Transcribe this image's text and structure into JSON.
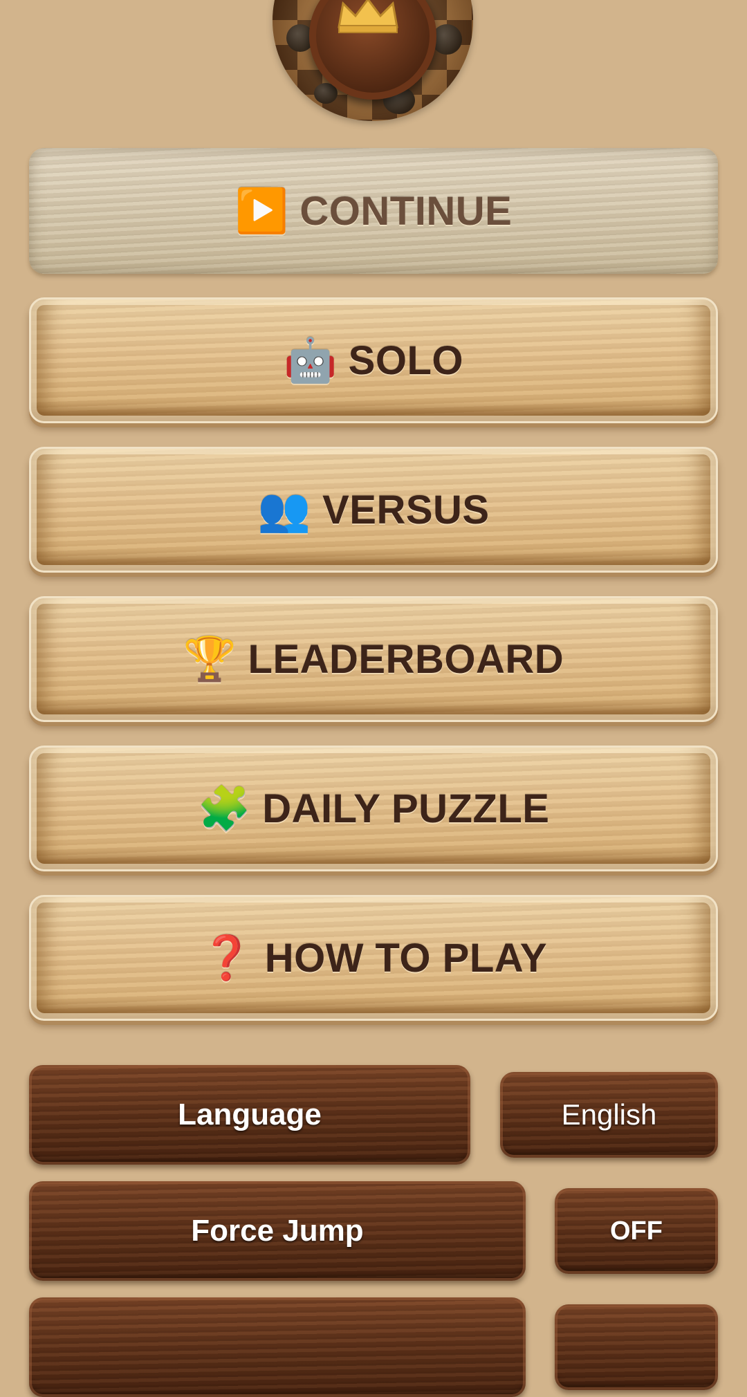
{
  "menu": {
    "continue": {
      "icon": "play-button-icon",
      "glyph": "▶️",
      "label": "CONTINUE"
    },
    "solo": {
      "icon": "robot-icon",
      "glyph": "🤖",
      "label": "SOLO"
    },
    "versus": {
      "icon": "two-people-icon",
      "glyph": "👥",
      "label": "VERSUS"
    },
    "leaderboard": {
      "icon": "trophy-icon",
      "glyph": "🏆",
      "label": "LEADERBOARD"
    },
    "daily_puzzle": {
      "icon": "puzzle-piece-icon",
      "glyph": "🧩",
      "label": "DAILY PUZZLE"
    },
    "how_to_play": {
      "icon": "question-mark-icon",
      "glyph": "❓",
      "label": "HOW TO PLAY"
    }
  },
  "settings": {
    "language": {
      "label": "Language",
      "value": "English"
    },
    "force_jump": {
      "label": "Force Jump",
      "value": "OFF"
    }
  },
  "colors": {
    "background": "#d2b48c",
    "button_text": "#3d2419",
    "dark_wood": "#5e3119"
  }
}
